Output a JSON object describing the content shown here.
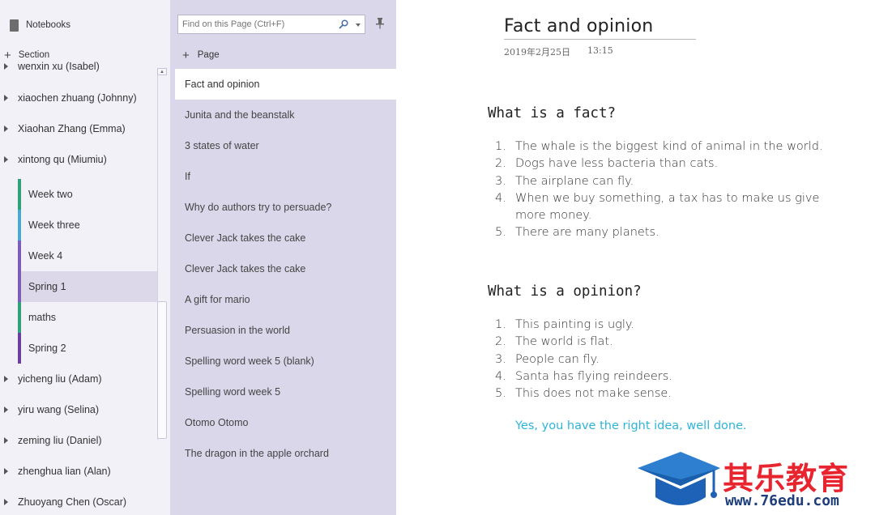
{
  "notebooks": {
    "label": "Notebooks",
    "section_add_label": "Section",
    "students": [
      {
        "name": "wenxin xu (Isabel)"
      },
      {
        "name": "xiaochen zhuang (Johnny)"
      },
      {
        "name": "Xiaohan Zhang (Emma)"
      },
      {
        "name": "xintong qu (Miumiu)"
      },
      {
        "name": "yicheng liu (Adam)"
      },
      {
        "name": "yiru wang (Selina)"
      },
      {
        "name": "zeming liu (Daniel)"
      },
      {
        "name": "zhenghua lian (Alan)"
      },
      {
        "name": "Zhuoyang Chen (Oscar)"
      }
    ],
    "sections": [
      {
        "label": "Week two",
        "color": "#2ea37a"
      },
      {
        "label": "Week three",
        "color": "#4aa8cf"
      },
      {
        "label": "Week 4",
        "color": "#7e5db8"
      },
      {
        "label": "Spring 1",
        "color": "#7e5db8"
      },
      {
        "label": "maths",
        "color": "#2ea37a"
      },
      {
        "label": "Spring 2",
        "color": "#6a3f9e"
      }
    ],
    "selected_section": "Spring 1"
  },
  "pages": {
    "search_placeholder": "Find on this Page (Ctrl+F)",
    "add_label": "Page",
    "items": [
      {
        "label": "Fact and opinion"
      },
      {
        "label": "Junita and the beanstalk"
      },
      {
        "label": "3 states of water"
      },
      {
        "label": "If"
      },
      {
        "label": "Why do authors try to persuade?"
      },
      {
        "label": "Clever Jack takes the cake"
      },
      {
        "label": "Clever Jack takes the cake"
      },
      {
        "label": "A gift for mario"
      },
      {
        "label": "Persuasion in the world"
      },
      {
        "label": "Spelling word week 5 (blank)"
      },
      {
        "label": "Spelling word week 5"
      },
      {
        "label": "Otomo Otomo"
      },
      {
        "label": "The dragon in the apple orchard"
      }
    ],
    "selected_page": "Fact and opinion"
  },
  "note": {
    "title": "Fact and opinion",
    "date": "2019年2月25日",
    "time": "13:15",
    "fact_heading": "What is a fact?",
    "facts": [
      {
        "num": "1.",
        "text": "The whale is the biggest kind of animal in the world."
      },
      {
        "num": "2.",
        "text": "Dogs have less bacteria than cats."
      },
      {
        "num": "3.",
        "text": "The airplane can fly."
      },
      {
        "num": "4.",
        "text": "When we buy something, a tax has to make us give more money."
      },
      {
        "num": "5.",
        "text": "There are many planets."
      }
    ],
    "opinion_heading": "What is a opinion?",
    "opinions": [
      {
        "num": "1.",
        "text": "This painting is ugly."
      },
      {
        "num": "2.",
        "text": "The world is flat."
      },
      {
        "num": "3.",
        "text": "People can fly."
      },
      {
        "num": "4.",
        "text": "Santa has flying reindeers."
      },
      {
        "num": "5.",
        "text": "This does not make sense."
      }
    ],
    "teacher_comment": "Yes, you have the right idea, well done."
  },
  "watermark": {
    "chinese": "其乐教育",
    "url": "www.76edu.com"
  },
  "colors": {
    "accent_purple": "#7e5db8",
    "comment_blue": "#2fb4d9",
    "watermark_red": "#e8242e",
    "watermark_navy": "#1d3d7a"
  }
}
